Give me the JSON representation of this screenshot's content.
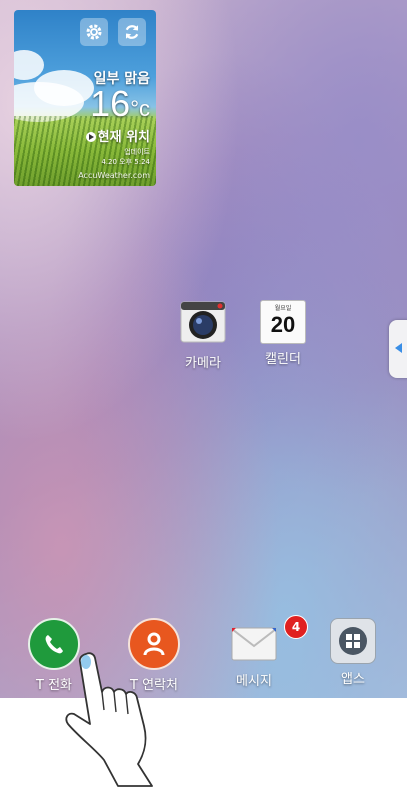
{
  "weather_widget": {
    "condition": "일부 맑음",
    "temperature": "16",
    "unit": "°c",
    "location": "현재 위치",
    "updated_label": "업데이트",
    "updated_time": "4.20 오후 5:24",
    "brand": "AccuWeather.com",
    "settings_icon": "gear-icon",
    "refresh_icon": "refresh-icon"
  },
  "home_icons": [
    {
      "label": "카메라",
      "icon": "camera-icon"
    },
    {
      "label": "캘린더",
      "icon": "calendar-icon",
      "calendar_day": "월요일",
      "calendar_date": "20"
    }
  ],
  "dock": [
    {
      "label": "T 전화",
      "icon": "phone-icon",
      "color": "#1f9a3c"
    },
    {
      "label": "T 연락처",
      "icon": "contacts-icon",
      "color": "#e8571f"
    },
    {
      "label": "메시지",
      "icon": "mail-icon",
      "badge": "4"
    },
    {
      "label": "앱스",
      "icon": "apps-icon"
    }
  ],
  "side_panel": {
    "icon": "chevron-left-icon"
  },
  "colors": {
    "accent": "#3a8ee6",
    "badge": "#e02020"
  }
}
